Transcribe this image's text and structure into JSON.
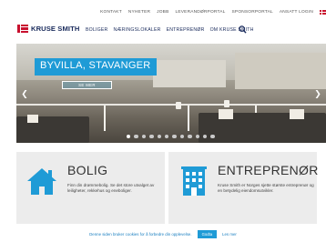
{
  "top_links": [
    "KONTAKT",
    "NYHETER",
    "JOBB",
    "LEVERANDØRPORTAL",
    "SPONSORPORTAL",
    "ANSATT LOGIN"
  ],
  "language_flag": "norway-flag-icon",
  "logo": {
    "text": "KRUSE SMITH",
    "icon": "kruse-smith-logo-icon",
    "color": "#c8102e"
  },
  "main_nav": [
    "BOLIGER",
    "NÆRINGSLOKALER",
    "ENTREPRENØR",
    "OM KRUSE SMITH"
  ],
  "search_icon": "search-icon",
  "hero": {
    "title": "BYVILLA, STAVANGER",
    "cta": "SE MER",
    "accent": "#1f9bd6",
    "slides_total": 12,
    "active_slide": 1
  },
  "cards": [
    {
      "title": "BOLIG",
      "text": "Finn din drømmebolig. Se det store utvalget av leiligheter, rekkehus og eneboliger.",
      "icon": "house-icon",
      "icon_color": "#1f9bd6"
    },
    {
      "title": "ENTREPRENØR",
      "text": "Kruse Smith er Norges sjette største entreprenør og en betydelig eiendomsutvikler.",
      "icon": "building-icon",
      "icon_color": "#1f9bd6"
    }
  ],
  "cookie": {
    "text": "Denne siden bruker cookies for å forbedre din opplevelse.",
    "ok": "Godta",
    "more": "Les mer"
  }
}
